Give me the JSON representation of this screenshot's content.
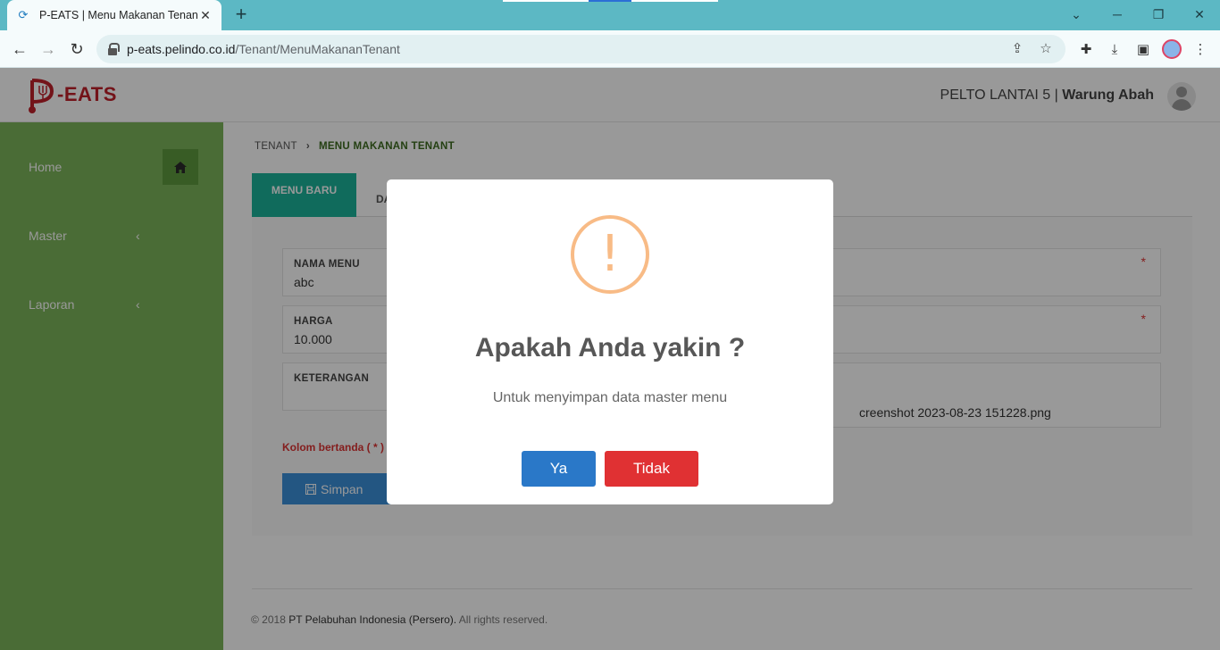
{
  "browser": {
    "tab_title": "P-EATS | Menu Makanan Tenant",
    "url_host": "p-eats.pelindo.co.id",
    "url_path": "/Tenant/MenuMakananTenant"
  },
  "header": {
    "logo_text": "-EATS",
    "location": "PELTO LANTAI 5",
    "separator": " | ",
    "tenant_name": "Warung Abah"
  },
  "sidebar": {
    "items": [
      {
        "label": "Home"
      },
      {
        "label": "Master"
      },
      {
        "label": "Laporan"
      }
    ]
  },
  "breadcrumb": {
    "parent": "TENANT",
    "current": "MENU MAKANAN TENANT"
  },
  "tabs": {
    "active": "MENU BARU",
    "other": "DA"
  },
  "form": {
    "nama_menu_label": "NAMA MENU",
    "nama_menu_value": "abc",
    "harga_label": "HARGA",
    "harga_value": "10.000",
    "keterangan_label": "KETERANGAN",
    "required_mark": "*",
    "file_name": "creenshot 2023-08-23 151228.png",
    "required_note": "Kolom bertanda ( * )",
    "save_label": "Simpan"
  },
  "footer": {
    "copyright": "© 2018 ",
    "company": "PT Pelabuhan Indonesia (Persero).",
    "rights": " All rights reserved."
  },
  "modal": {
    "icon_glyph": "!",
    "title": "Apakah Anda yakin ?",
    "text": "Untuk menyimpan data master menu",
    "yes_label": "Ya",
    "no_label": "Tidak"
  },
  "colors": {
    "sidebar": "#7cb45a",
    "tab_active": "#1bb39a",
    "brand": "#c0202a",
    "yes_button": "#2a78c8",
    "no_button": "#e03133",
    "warning": "#f8bb86"
  }
}
